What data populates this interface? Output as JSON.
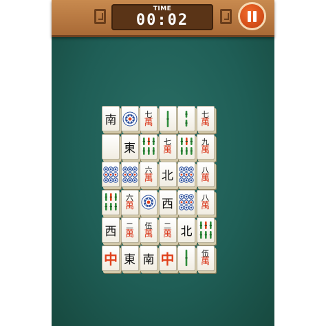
{
  "header": {
    "timer_label": "TIME",
    "timer_value": "00:02"
  },
  "colors": {
    "felt": "#1f5e56",
    "wood": "#b87743",
    "pause": "#e0541c",
    "dragon_red": "#e0401a",
    "bamboo_green": "#2f8c3b",
    "circle_blue": "#2a4f9e"
  },
  "tiles": [
    {
      "col": 0,
      "row": 0,
      "kind": "wind",
      "text": "南"
    },
    {
      "col": 1,
      "row": 0,
      "kind": "circle-one"
    },
    {
      "col": 2,
      "row": 0,
      "kind": "character",
      "num": "七",
      "suit": "萬"
    },
    {
      "col": 3,
      "row": 0,
      "kind": "bamboo-one"
    },
    {
      "col": 4,
      "row": 0,
      "kind": "bamboo-two"
    },
    {
      "col": 5,
      "row": 0,
      "kind": "character",
      "num": "七",
      "suit": "萬"
    },
    {
      "col": 0,
      "row": 1,
      "kind": "blank"
    },
    {
      "col": 1,
      "row": 1,
      "kind": "wind",
      "text": "東"
    },
    {
      "col": 2,
      "row": 1,
      "kind": "bamboo-many"
    },
    {
      "col": 3,
      "row": 1,
      "kind": "character",
      "num": "七",
      "suit": "萬"
    },
    {
      "col": 4,
      "row": 1,
      "kind": "bamboo-many"
    },
    {
      "col": 5,
      "row": 1,
      "kind": "character",
      "num": "九",
      "suit": "萬"
    },
    {
      "col": 0,
      "row": 2,
      "kind": "circles"
    },
    {
      "col": 1,
      "row": 2,
      "kind": "circles"
    },
    {
      "col": 2,
      "row": 2,
      "kind": "character",
      "num": "六",
      "suit": "萬"
    },
    {
      "col": 3,
      "row": 2,
      "kind": "wind",
      "text": "北"
    },
    {
      "col": 4,
      "row": 2,
      "kind": "circles"
    },
    {
      "col": 5,
      "row": 2,
      "kind": "character",
      "num": "八",
      "suit": "萬"
    },
    {
      "col": 0,
      "row": 3,
      "kind": "bamboo-many"
    },
    {
      "col": 1,
      "row": 3,
      "kind": "character",
      "num": "六",
      "suit": "萬"
    },
    {
      "col": 2,
      "row": 3,
      "kind": "circle-one"
    },
    {
      "col": 3,
      "row": 3,
      "kind": "wind",
      "text": "西"
    },
    {
      "col": 4,
      "row": 3,
      "kind": "circles"
    },
    {
      "col": 5,
      "row": 3,
      "kind": "character",
      "num": "八",
      "suit": "萬"
    },
    {
      "col": 0,
      "row": 4,
      "kind": "wind",
      "text": "西"
    },
    {
      "col": 1,
      "row": 4,
      "kind": "character",
      "num": "二",
      "suit": "萬"
    },
    {
      "col": 2,
      "row": 4,
      "kind": "character",
      "num": "伍",
      "suit": "萬"
    },
    {
      "col": 3,
      "row": 4,
      "kind": "character",
      "num": "二",
      "suit": "萬"
    },
    {
      "col": 4,
      "row": 4,
      "kind": "wind",
      "text": "北"
    },
    {
      "col": 5,
      "row": 4,
      "kind": "bamboo-many"
    },
    {
      "col": 0,
      "row": 5,
      "kind": "red",
      "text": "中"
    },
    {
      "col": 1,
      "row": 5,
      "kind": "wind",
      "text": "東"
    },
    {
      "col": 2,
      "row": 5,
      "kind": "wind",
      "text": "南"
    },
    {
      "col": 3,
      "row": 5,
      "kind": "red",
      "text": "中"
    },
    {
      "col": 4,
      "row": 5,
      "kind": "bamboo-one"
    },
    {
      "col": 5,
      "row": 5,
      "kind": "character",
      "num": "伍",
      "suit": "萬"
    }
  ]
}
